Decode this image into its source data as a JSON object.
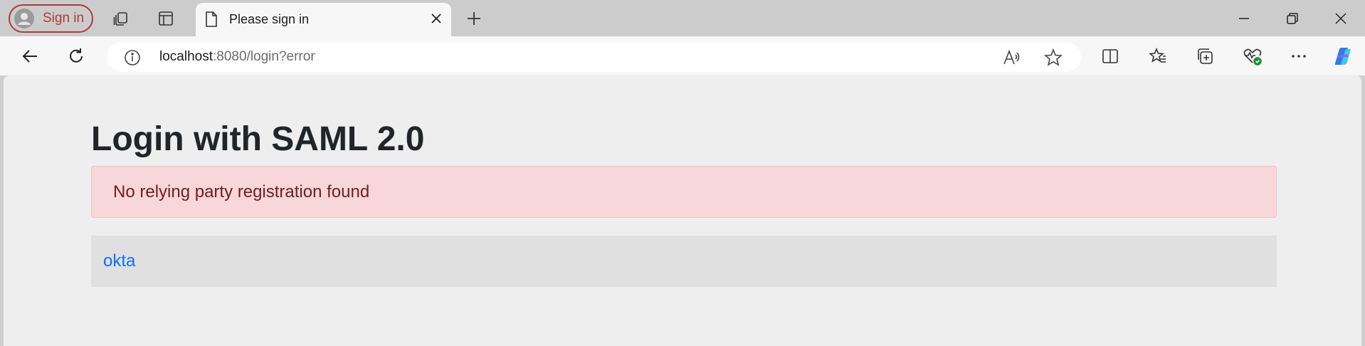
{
  "browser": {
    "profile_label": "Sign in",
    "tab": {
      "title": "Please sign in"
    },
    "address": {
      "host": "localhost",
      "rest": ":8080/login?error"
    }
  },
  "page": {
    "heading": "Login with SAML 2.0",
    "error_message": "No relying party registration found",
    "providers": [
      "okta"
    ]
  },
  "colors": {
    "error_bg": "#f8d7da",
    "error_text": "#721c24",
    "link": "#0d6efd",
    "profile_accent": "#b03a3a"
  },
  "icons": [
    "avatar-icon",
    "workspaces-icon",
    "tab-actions-icon",
    "document-icon",
    "close-icon",
    "new-tab-icon",
    "minimize-icon",
    "restore-icon",
    "window-close-icon",
    "back-icon",
    "refresh-icon",
    "info-icon",
    "read-aloud-icon",
    "favorite-star-icon",
    "split-screen-icon",
    "favorites-icon",
    "collections-icon",
    "browser-essentials-icon",
    "more-icon",
    "copilot-icon"
  ]
}
